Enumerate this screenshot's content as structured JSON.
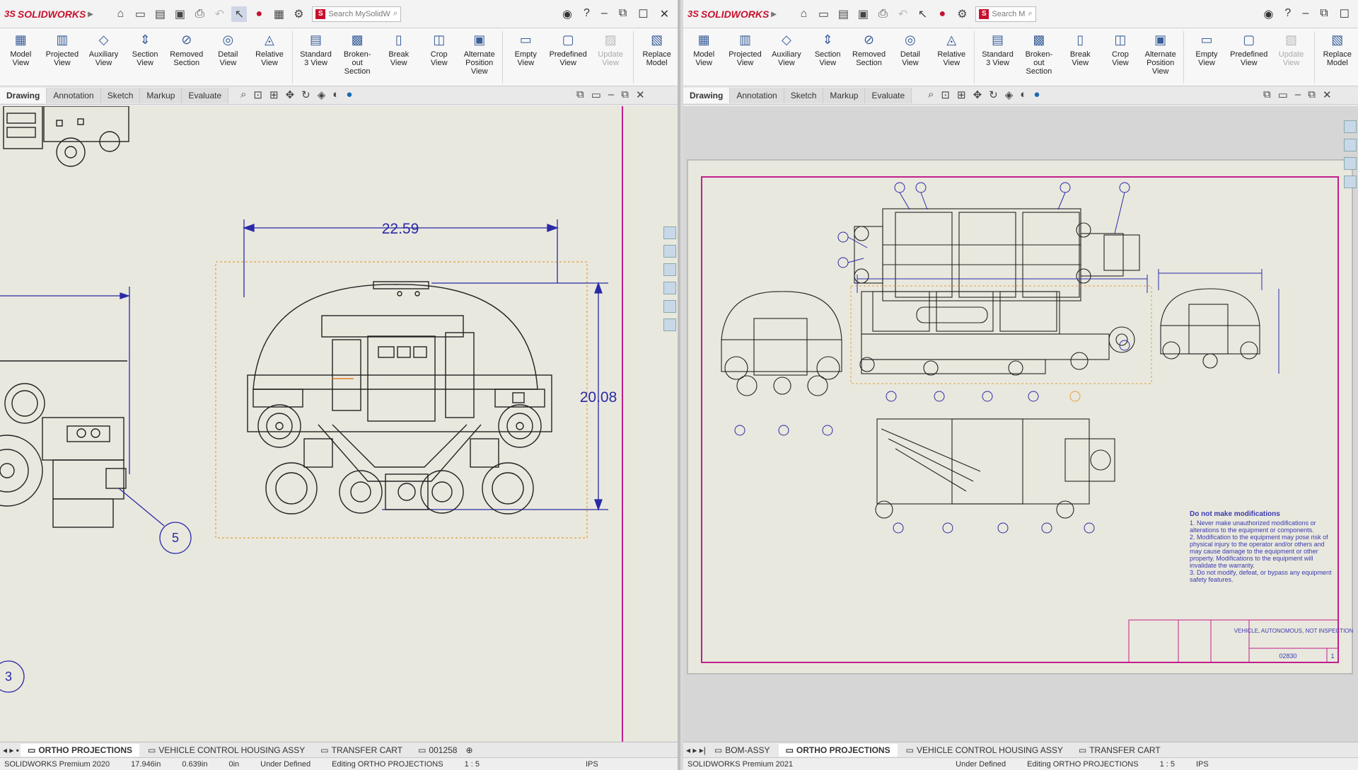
{
  "left": {
    "logo": "SOLIDWORKS",
    "search_placeholder": "Search MySolidW",
    "ribbon": [
      {
        "label": "Model View"
      },
      {
        "label": "Projected View"
      },
      {
        "label": "Auxiliary View"
      },
      {
        "label": "Section View"
      },
      {
        "label": "Removed Section"
      },
      {
        "label": "Detail View"
      },
      {
        "label": "Relative View"
      },
      {
        "label": "Standard 3 View"
      },
      {
        "label": "Broken-out Section"
      },
      {
        "label": "Break View"
      },
      {
        "label": "Crop View"
      },
      {
        "label": "Alternate Position View"
      },
      {
        "label": "Empty View"
      },
      {
        "label": "Predefined View"
      },
      {
        "label": "Update View"
      },
      {
        "label": "Replace Model"
      }
    ],
    "tabs": [
      "Drawing",
      "Annotation",
      "Sketch",
      "Markup",
      "Evaluate"
    ],
    "dim_width": "22.59",
    "dim_height": "20.08",
    "balloon_5": "5",
    "balloon_3": "3",
    "sheet_tabs": [
      "ORTHO PROJECTIONS",
      "VEHICLE CONTROL HOUSING ASSY",
      "TRANSFER CART",
      "001258"
    ],
    "status": {
      "product": "SOLIDWORKS Premium 2020",
      "x": "17.946in",
      "y": "0.639in",
      "z": "0in",
      "state": "Under Defined",
      "editing": "Editing ORTHO PROJECTIONS",
      "scale": "1 : 5",
      "units": "IPS"
    }
  },
  "right": {
    "logo": "SOLIDWORKS",
    "search_placeholder": "Search M",
    "ribbon": [
      {
        "label": "Model View"
      },
      {
        "label": "Projected View"
      },
      {
        "label": "Auxiliary View"
      },
      {
        "label": "Section View"
      },
      {
        "label": "Removed Section"
      },
      {
        "label": "Detail View"
      },
      {
        "label": "Relative View"
      },
      {
        "label": "Standard 3 View"
      },
      {
        "label": "Broken-out Section"
      },
      {
        "label": "Break View"
      },
      {
        "label": "Crop View"
      },
      {
        "label": "Alternate Position View"
      },
      {
        "label": "Empty View"
      },
      {
        "label": "Predefined View"
      },
      {
        "label": "Update View"
      },
      {
        "label": "Replace Model"
      }
    ],
    "tabs": [
      "Drawing",
      "Annotation",
      "Sketch",
      "Markup",
      "Evaluate"
    ],
    "notes_title": "Do not make modifications",
    "notes": [
      "1. Never make unauthorized modifications or alterations to the equipment or components.",
      "2. Modification to the equipment may pose risk of physical injury to the operator and/or others and may cause damage to the equipment or other property. Modifications to the equipment will invalidate the warranty.",
      "3. Do not modify, defeat, or bypass any equipment safety features."
    ],
    "title_block": {
      "title": "VEHICLE, AUTONOMOUS, NOT INSPECTION",
      "number": "02830",
      "sheet": "1"
    },
    "sheet_tabs": [
      "BOM-ASSY",
      "ORTHO PROJECTIONS",
      "VEHICLE CONTROL HOUSING ASSY",
      "TRANSFER CART"
    ],
    "status": {
      "product": "SOLIDWORKS Premium 2021",
      "state": "Under Defined",
      "editing": "Editing ORTHO PROJECTIONS",
      "scale": "1 : 5",
      "units": "IPS"
    }
  },
  "colors": {
    "dimension": "#2a2aa8",
    "sheet_border": "#c0208a",
    "view_box": "#e0a040",
    "brand": "#c8102e"
  }
}
